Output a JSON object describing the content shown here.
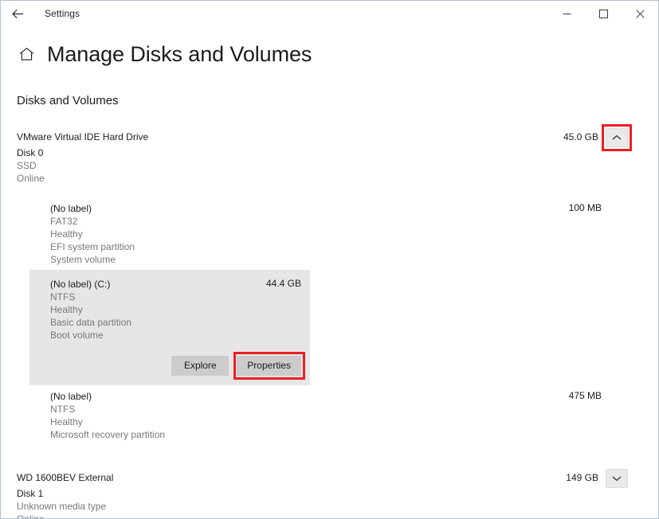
{
  "window": {
    "app_title": "Settings",
    "back_icon": "back-arrow-icon",
    "minimize_icon": "minimize-icon",
    "maximize_icon": "maximize-icon",
    "close_icon": "close-icon"
  },
  "page": {
    "home_icon": "home-icon",
    "title": "Manage Disks and Volumes",
    "section_title": "Disks and Volumes"
  },
  "annotations": {
    "color": "#ee1d24",
    "targets": [
      "disk0-chevron-button",
      "properties-button"
    ]
  },
  "disks": [
    {
      "name": "VMware Virtual IDE Hard Drive",
      "size": "45.0 GB",
      "disk_number": "Disk 0",
      "media_type": "SSD",
      "status": "Online",
      "expanded": true,
      "chevron_icon": "chevron-up-icon",
      "volumes": [
        {
          "label": "(No label)",
          "size": "100 MB",
          "filesystem": "FAT32",
          "health": "Healthy",
          "partition": "EFI system partition",
          "role": "System volume",
          "selected": false
        },
        {
          "label": "(No label) (C:)",
          "size": "44.4 GB",
          "filesystem": "NTFS",
          "health": "Healthy",
          "partition": "Basic data partition",
          "role": "Boot volume",
          "selected": true,
          "actions": {
            "explore_label": "Explore",
            "properties_label": "Properties"
          }
        },
        {
          "label": "(No label)",
          "size": "475 MB",
          "filesystem": "NTFS",
          "health": "Healthy",
          "partition": "Microsoft recovery partition",
          "role": "",
          "selected": false
        }
      ]
    },
    {
      "name": "WD 1600BEV External",
      "size": "149 GB",
      "disk_number": "Disk 1",
      "media_type": "Unknown media type",
      "status": "Online",
      "expanded": false,
      "chevron_icon": "chevron-down-icon",
      "volumes": []
    }
  ]
}
